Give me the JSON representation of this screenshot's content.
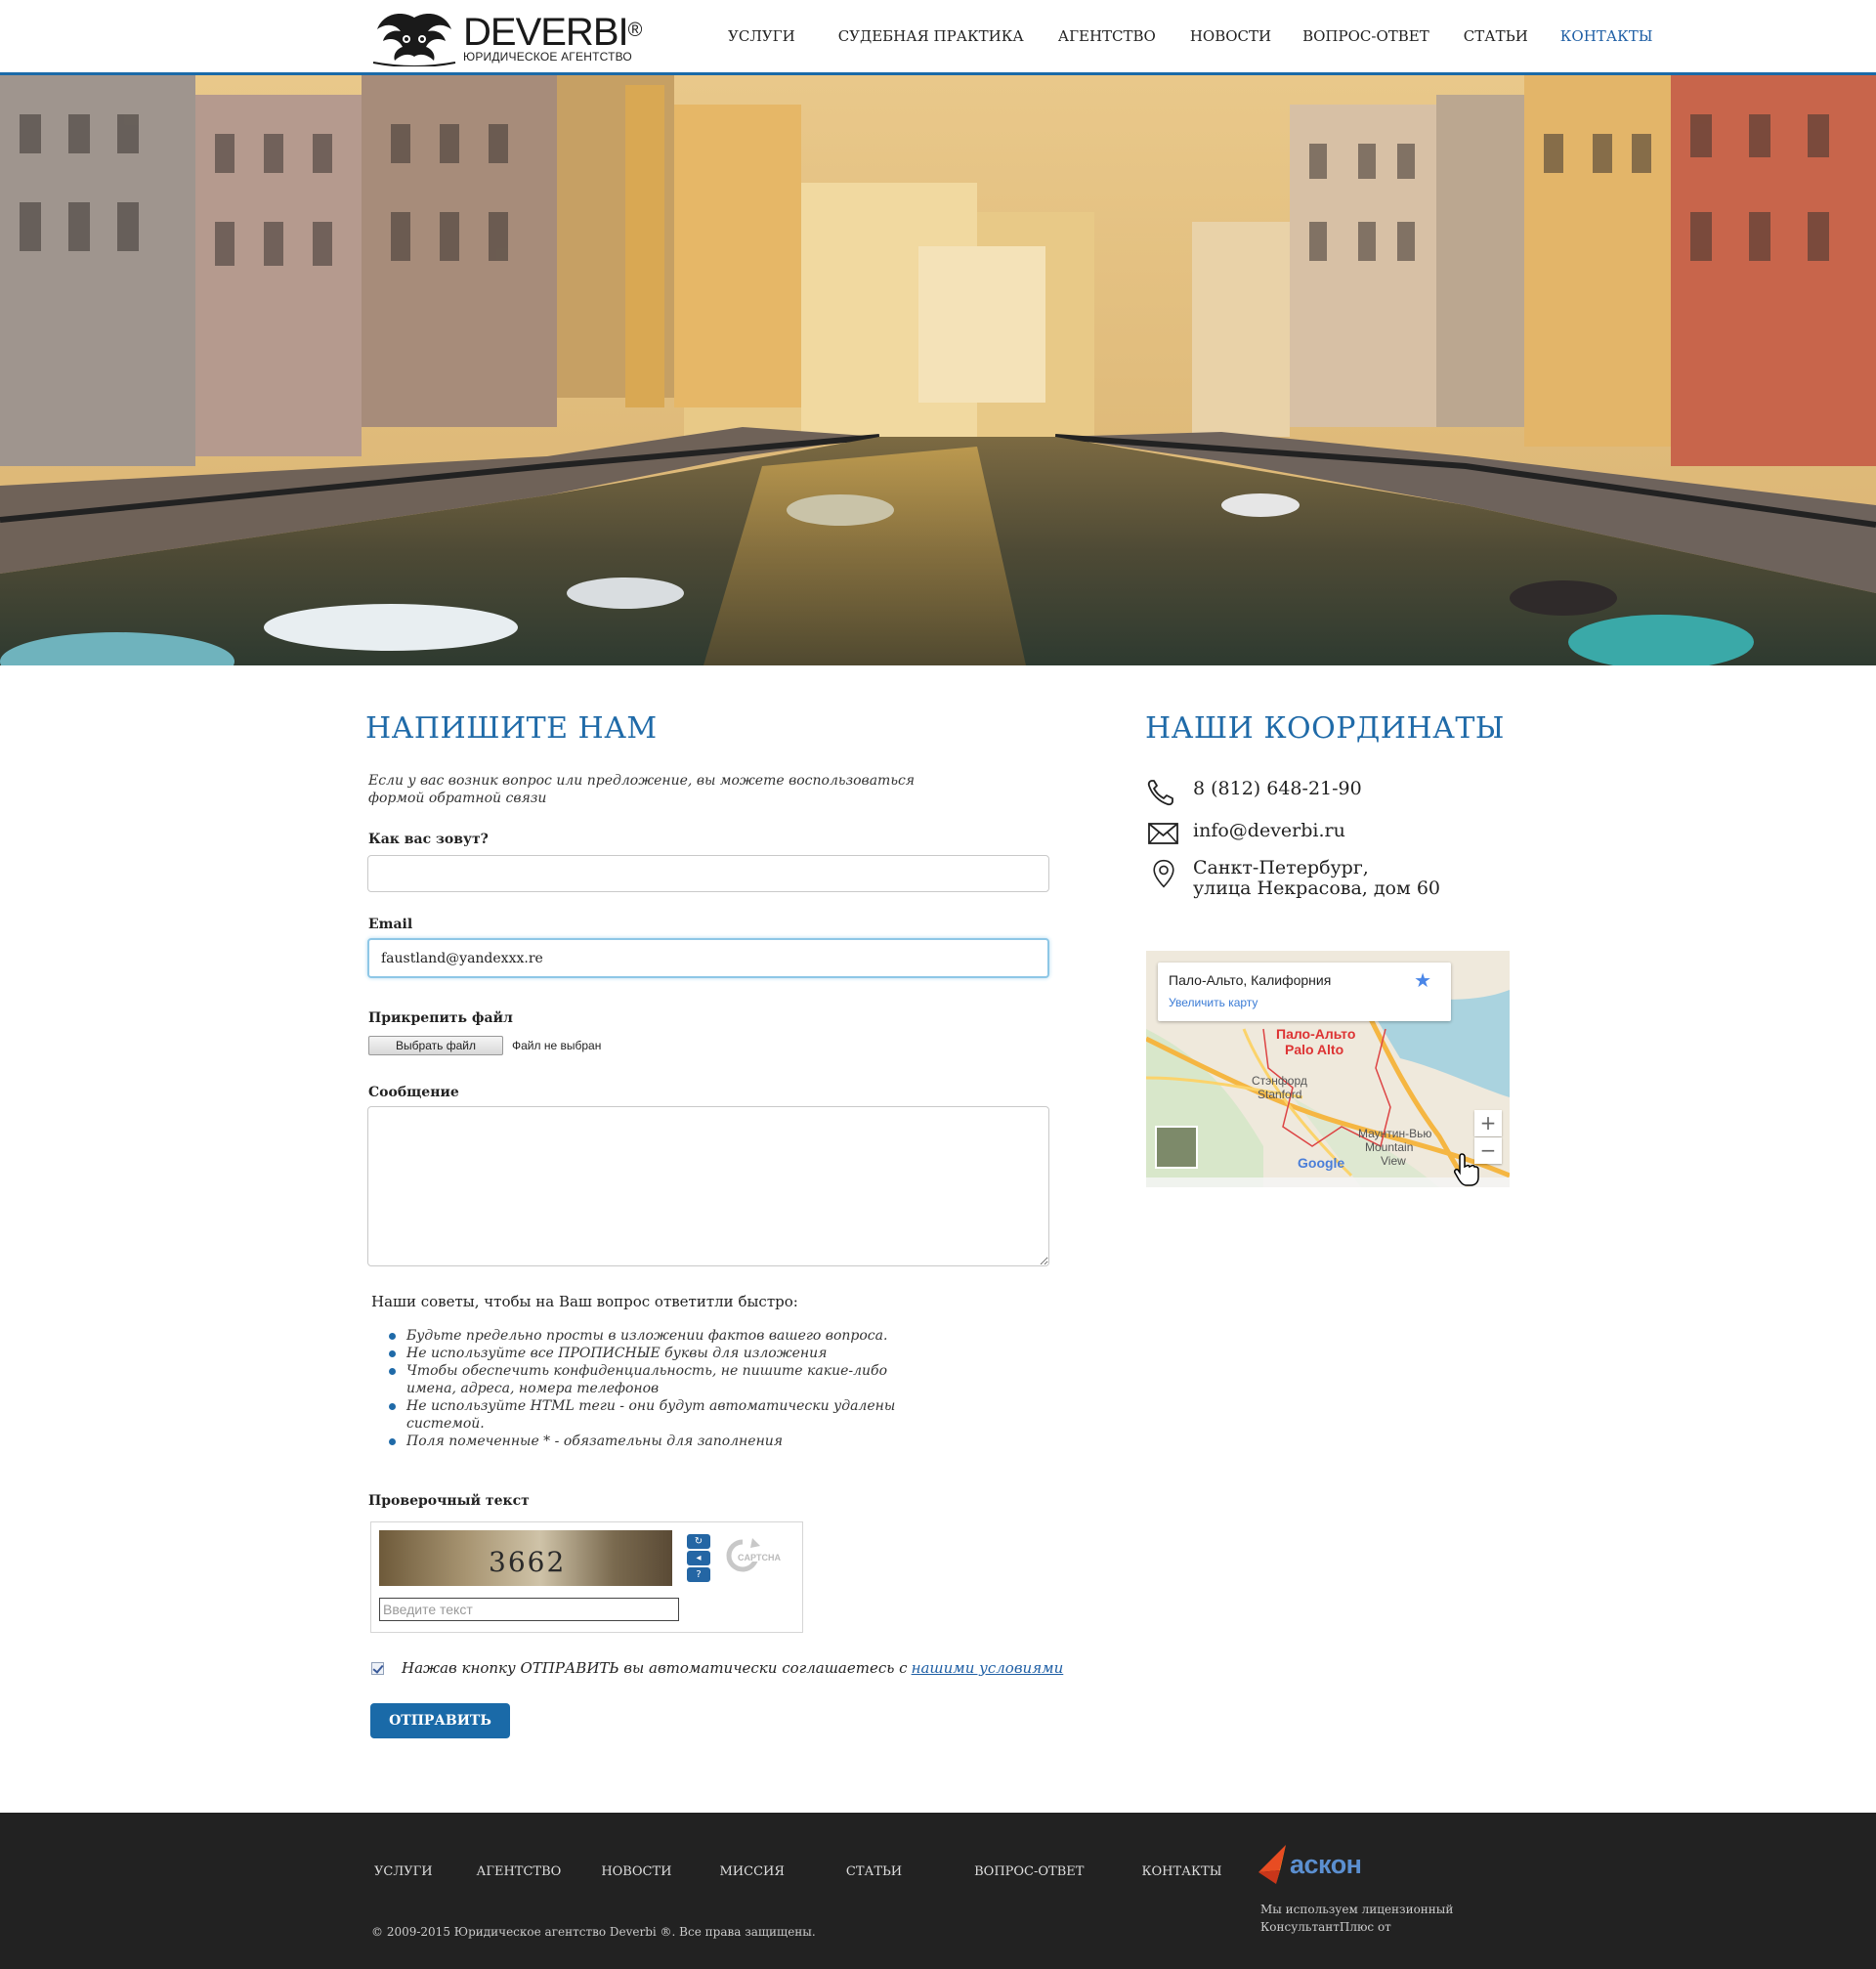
{
  "header": {
    "logo_name": "DEVERBI",
    "logo_reg": "®",
    "logo_sub": "ЮРИДИЧЕСКОЕ АГЕНТСТВО",
    "nav": [
      "УСЛУГИ",
      "СУДЕБНАЯ ПРАКТИКА",
      "АГЕНТСТВО",
      "НОВОСТИ",
      "ВОПРОС-ОТВЕТ",
      "СТАТЬИ",
      "КОНТАКТЫ"
    ],
    "accent_color": "#1a6aa8"
  },
  "hero": {
    "subject": "Saint Petersburg canal with boats at sunset"
  },
  "form": {
    "title": "НАПИШИТЕ НАМ",
    "intro": "Если у вас возник вопрос или предложение, вы можете воспользоваться формой обратной связи",
    "name_label": "Как вас зовут?",
    "name_value": "",
    "email_label": "Email",
    "email_value": "faustland@yandexxx.re",
    "file_label": "Прикрепить файл",
    "file_button": "Выбрать файл",
    "file_status": "Файл не выбран",
    "message_label": "Сообщение",
    "message_value": "",
    "tips_title": "Наши советы, чтобы на Ваш вопрос ответитли быстро:",
    "tips": [
      "Будьте предельно просты в изложении фактов вашего вопроса.",
      "Не используйте все ПРОПИСНЫЕ буквы для изложения",
      "Чтобы обеспечить конфиденциальность, не пишите какие-либо имена, адреса, номера телефонов",
      "Не используйте HTML теги - они будут автоматически удалены системой.",
      "Поля помеченные * - обязательны для заполнения"
    ],
    "captcha_label": "Проверочный текст",
    "captcha_word": "3662",
    "captcha_placeholder": "Введите текст",
    "captcha_icons": [
      "refresh-icon",
      "audio-icon",
      "help-icon"
    ],
    "agree_text": "Нажав кнопку ОТПРАВИТЬ вы автоматически соглашаетесь с",
    "agree_link": "нашими условиями",
    "agree_checked": true,
    "submit_label": "ОТПРАВИТЬ"
  },
  "contacts": {
    "title": "НАШИ КООРДИНАТЫ",
    "phone": "8 (812) 648-21-90",
    "email": "info@deverbi.ru",
    "address_line1": "Санкт-Петербург,",
    "address_line2": "улица Некрасова, дом 60",
    "map": {
      "place": "Пало-Альто, Калифорния",
      "enlarge_link": "Увеличить карту",
      "labels": [
        "Пало-Альто",
        "Palo Alto",
        "Стэнфорд",
        "Stanford",
        "Маунтин-Вью",
        "Mountain",
        "View"
      ],
      "zoom_in": "+",
      "zoom_out": "−"
    }
  },
  "footer": {
    "nav": [
      "УСЛУГИ",
      "АГЕНТСТВО",
      "НОВОСТИ",
      "МИССИЯ",
      "СТАТЬИ",
      "ВОПРОС-ОТВЕТ",
      "КОНТАКТЫ"
    ],
    "copyright": "© 2009-2015 Юридическое агентство Deverbi ®. Все права защищены.",
    "partner_name": "аскон",
    "partner_text": "Мы используем лицензионный КонсультантПлюс от"
  }
}
